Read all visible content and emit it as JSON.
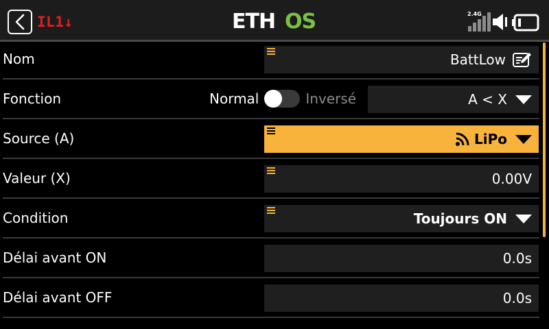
{
  "header": {
    "label": "IL1↓",
    "logo_text": "ETHOS",
    "signal_label": "2.4G",
    "accent_color": "#f8b33c",
    "logo_green": "#7ac143",
    "label_color": "#e02020"
  },
  "rows": {
    "nom": {
      "label": "Nom",
      "value": "BattLow"
    },
    "fonction": {
      "label": "Fonction",
      "toggle_left": "Normal",
      "toggle_right": "Inversé",
      "value": "A < X"
    },
    "source": {
      "label": "Source (A)",
      "value": "LiPo"
    },
    "valeur": {
      "label": "Valeur (X)",
      "value": "0.00V"
    },
    "condition": {
      "label": "Condition",
      "value": "Toujours ON"
    },
    "delai_on": {
      "label": "Délai avant ON",
      "value": "0.0s"
    },
    "delai_off": {
      "label": "Délai avant OFF",
      "value": "0.0s"
    }
  }
}
